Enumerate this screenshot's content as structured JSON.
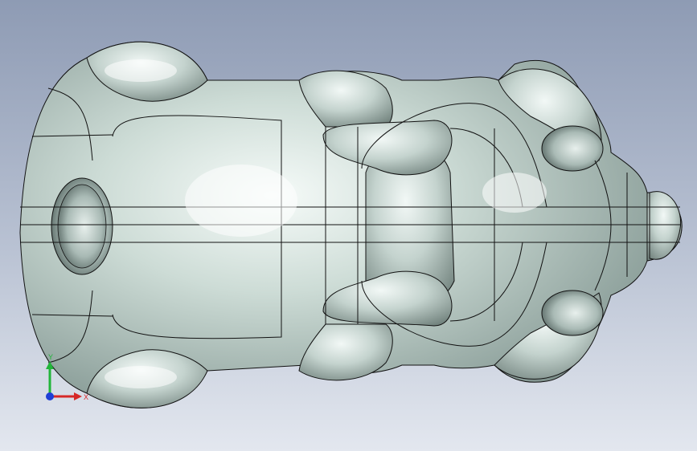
{
  "viewport": {
    "background_top": "#8e9bb4",
    "background_bottom": "#e3e7ef",
    "model_color": "#c9d8d3",
    "edge_color": "#121212"
  },
  "triad": {
    "x_label": "X",
    "y_label": "Y",
    "x_color": "#d62828",
    "y_color": "#22b53a",
    "z_color": "#1f3fd6"
  }
}
